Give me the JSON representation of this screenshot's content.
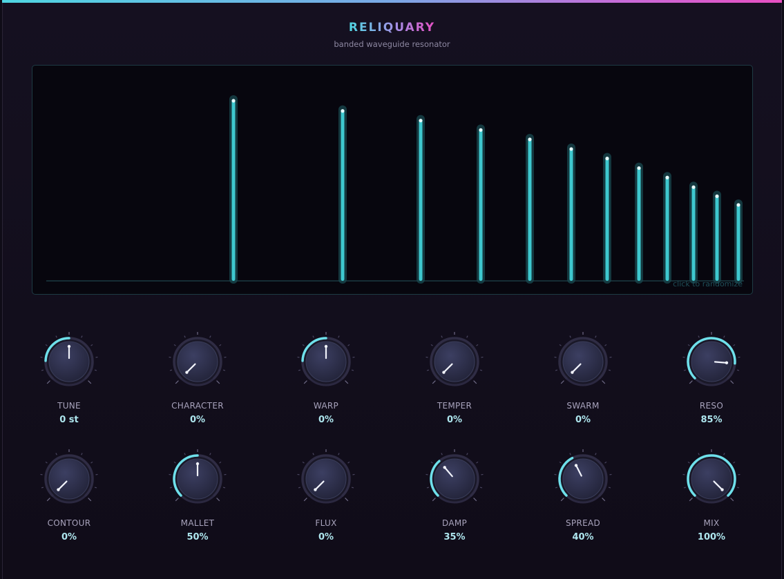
{
  "header": {
    "title": "RELIQUARY",
    "subtitle": "banded waveguide resonator"
  },
  "display": {
    "hint": "click to randomize",
    "bar_color": "#3ec8cf",
    "bar_levels": [
      1.0,
      0.944,
      0.891,
      0.839,
      0.787,
      0.734,
      0.682,
      0.629,
      0.577,
      0.524,
      0.474,
      0.426
    ]
  },
  "colors": {
    "accent": "#6ee0ea",
    "knob_body": "#2d3050",
    "label": "#a8a3bc",
    "value": "#aee6ee"
  },
  "knobs": [
    {
      "id": "tune",
      "label": "TUNE",
      "value": "0 st",
      "bipolar": true,
      "level": 0.5
    },
    {
      "id": "character",
      "label": "CHARACTER",
      "value": "0%",
      "bipolar": false,
      "level": 0.0
    },
    {
      "id": "warp",
      "label": "WARP",
      "value": "0%",
      "bipolar": true,
      "level": 0.5
    },
    {
      "id": "temper",
      "label": "TEMPER",
      "value": "0%",
      "bipolar": false,
      "level": 0.0
    },
    {
      "id": "swarm",
      "label": "SWARM",
      "value": "0%",
      "bipolar": false,
      "level": 0.0
    },
    {
      "id": "reso",
      "label": "RESO",
      "value": "85%",
      "bipolar": false,
      "level": 0.85
    },
    {
      "id": "contour",
      "label": "CONTOUR",
      "value": "0%",
      "bipolar": false,
      "level": 0.0
    },
    {
      "id": "mallet",
      "label": "MALLET",
      "value": "50%",
      "bipolar": false,
      "level": 0.5
    },
    {
      "id": "flux",
      "label": "FLUX",
      "value": "0%",
      "bipolar": false,
      "level": 0.0
    },
    {
      "id": "damp",
      "label": "DAMP",
      "value": "35%",
      "bipolar": false,
      "level": 0.35
    },
    {
      "id": "spread",
      "label": "SPREAD",
      "value": "40%",
      "bipolar": false,
      "level": 0.4
    },
    {
      "id": "mix",
      "label": "MIX",
      "value": "100%",
      "bipolar": false,
      "level": 1.0
    }
  ]
}
